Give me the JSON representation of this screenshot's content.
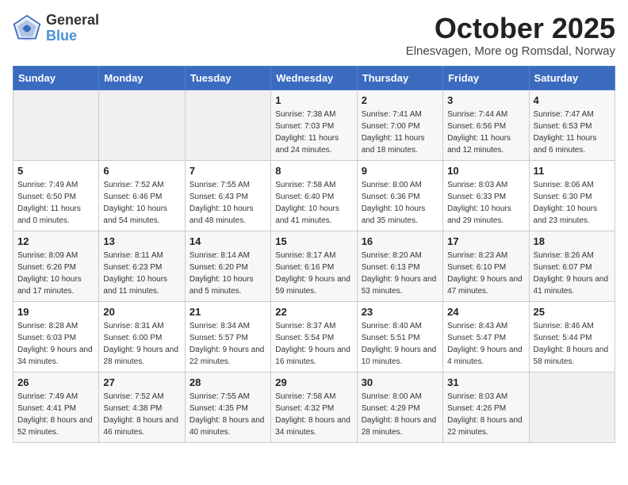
{
  "header": {
    "logo_line1": "General",
    "logo_line2": "Blue",
    "month": "October 2025",
    "location": "Elnesvagen, More og Romsdal, Norway"
  },
  "weekdays": [
    "Sunday",
    "Monday",
    "Tuesday",
    "Wednesday",
    "Thursday",
    "Friday",
    "Saturday"
  ],
  "weeks": [
    [
      {
        "day": "",
        "sunrise": "",
        "sunset": "",
        "daylight": ""
      },
      {
        "day": "",
        "sunrise": "",
        "sunset": "",
        "daylight": ""
      },
      {
        "day": "",
        "sunrise": "",
        "sunset": "",
        "daylight": ""
      },
      {
        "day": "1",
        "sunrise": "Sunrise: 7:38 AM",
        "sunset": "Sunset: 7:03 PM",
        "daylight": "Daylight: 11 hours and 24 minutes."
      },
      {
        "day": "2",
        "sunrise": "Sunrise: 7:41 AM",
        "sunset": "Sunset: 7:00 PM",
        "daylight": "Daylight: 11 hours and 18 minutes."
      },
      {
        "day": "3",
        "sunrise": "Sunrise: 7:44 AM",
        "sunset": "Sunset: 6:56 PM",
        "daylight": "Daylight: 11 hours and 12 minutes."
      },
      {
        "day": "4",
        "sunrise": "Sunrise: 7:47 AM",
        "sunset": "Sunset: 6:53 PM",
        "daylight": "Daylight: 11 hours and 6 minutes."
      }
    ],
    [
      {
        "day": "5",
        "sunrise": "Sunrise: 7:49 AM",
        "sunset": "Sunset: 6:50 PM",
        "daylight": "Daylight: 11 hours and 0 minutes."
      },
      {
        "day": "6",
        "sunrise": "Sunrise: 7:52 AM",
        "sunset": "Sunset: 6:46 PM",
        "daylight": "Daylight: 10 hours and 54 minutes."
      },
      {
        "day": "7",
        "sunrise": "Sunrise: 7:55 AM",
        "sunset": "Sunset: 6:43 PM",
        "daylight": "Daylight: 10 hours and 48 minutes."
      },
      {
        "day": "8",
        "sunrise": "Sunrise: 7:58 AM",
        "sunset": "Sunset: 6:40 PM",
        "daylight": "Daylight: 10 hours and 41 minutes."
      },
      {
        "day": "9",
        "sunrise": "Sunrise: 8:00 AM",
        "sunset": "Sunset: 6:36 PM",
        "daylight": "Daylight: 10 hours and 35 minutes."
      },
      {
        "day": "10",
        "sunrise": "Sunrise: 8:03 AM",
        "sunset": "Sunset: 6:33 PM",
        "daylight": "Daylight: 10 hours and 29 minutes."
      },
      {
        "day": "11",
        "sunrise": "Sunrise: 8:06 AM",
        "sunset": "Sunset: 6:30 PM",
        "daylight": "Daylight: 10 hours and 23 minutes."
      }
    ],
    [
      {
        "day": "12",
        "sunrise": "Sunrise: 8:09 AM",
        "sunset": "Sunset: 6:26 PM",
        "daylight": "Daylight: 10 hours and 17 minutes."
      },
      {
        "day": "13",
        "sunrise": "Sunrise: 8:11 AM",
        "sunset": "Sunset: 6:23 PM",
        "daylight": "Daylight: 10 hours and 11 minutes."
      },
      {
        "day": "14",
        "sunrise": "Sunrise: 8:14 AM",
        "sunset": "Sunset: 6:20 PM",
        "daylight": "Daylight: 10 hours and 5 minutes."
      },
      {
        "day": "15",
        "sunrise": "Sunrise: 8:17 AM",
        "sunset": "Sunset: 6:16 PM",
        "daylight": "Daylight: 9 hours and 59 minutes."
      },
      {
        "day": "16",
        "sunrise": "Sunrise: 8:20 AM",
        "sunset": "Sunset: 6:13 PM",
        "daylight": "Daylight: 9 hours and 53 minutes."
      },
      {
        "day": "17",
        "sunrise": "Sunrise: 8:23 AM",
        "sunset": "Sunset: 6:10 PM",
        "daylight": "Daylight: 9 hours and 47 minutes."
      },
      {
        "day": "18",
        "sunrise": "Sunrise: 8:26 AM",
        "sunset": "Sunset: 6:07 PM",
        "daylight": "Daylight: 9 hours and 41 minutes."
      }
    ],
    [
      {
        "day": "19",
        "sunrise": "Sunrise: 8:28 AM",
        "sunset": "Sunset: 6:03 PM",
        "daylight": "Daylight: 9 hours and 34 minutes."
      },
      {
        "day": "20",
        "sunrise": "Sunrise: 8:31 AM",
        "sunset": "Sunset: 6:00 PM",
        "daylight": "Daylight: 9 hours and 28 minutes."
      },
      {
        "day": "21",
        "sunrise": "Sunrise: 8:34 AM",
        "sunset": "Sunset: 5:57 PM",
        "daylight": "Daylight: 9 hours and 22 minutes."
      },
      {
        "day": "22",
        "sunrise": "Sunrise: 8:37 AM",
        "sunset": "Sunset: 5:54 PM",
        "daylight": "Daylight: 9 hours and 16 minutes."
      },
      {
        "day": "23",
        "sunrise": "Sunrise: 8:40 AM",
        "sunset": "Sunset: 5:51 PM",
        "daylight": "Daylight: 9 hours and 10 minutes."
      },
      {
        "day": "24",
        "sunrise": "Sunrise: 8:43 AM",
        "sunset": "Sunset: 5:47 PM",
        "daylight": "Daylight: 9 hours and 4 minutes."
      },
      {
        "day": "25",
        "sunrise": "Sunrise: 8:46 AM",
        "sunset": "Sunset: 5:44 PM",
        "daylight": "Daylight: 8 hours and 58 minutes."
      }
    ],
    [
      {
        "day": "26",
        "sunrise": "Sunrise: 7:49 AM",
        "sunset": "Sunset: 4:41 PM",
        "daylight": "Daylight: 8 hours and 52 minutes."
      },
      {
        "day": "27",
        "sunrise": "Sunrise: 7:52 AM",
        "sunset": "Sunset: 4:38 PM",
        "daylight": "Daylight: 8 hours and 46 minutes."
      },
      {
        "day": "28",
        "sunrise": "Sunrise: 7:55 AM",
        "sunset": "Sunset: 4:35 PM",
        "daylight": "Daylight: 8 hours and 40 minutes."
      },
      {
        "day": "29",
        "sunrise": "Sunrise: 7:58 AM",
        "sunset": "Sunset: 4:32 PM",
        "daylight": "Daylight: 8 hours and 34 minutes."
      },
      {
        "day": "30",
        "sunrise": "Sunrise: 8:00 AM",
        "sunset": "Sunset: 4:29 PM",
        "daylight": "Daylight: 8 hours and 28 minutes."
      },
      {
        "day": "31",
        "sunrise": "Sunrise: 8:03 AM",
        "sunset": "Sunset: 4:26 PM",
        "daylight": "Daylight: 8 hours and 22 minutes."
      },
      {
        "day": "",
        "sunrise": "",
        "sunset": "",
        "daylight": ""
      }
    ]
  ]
}
